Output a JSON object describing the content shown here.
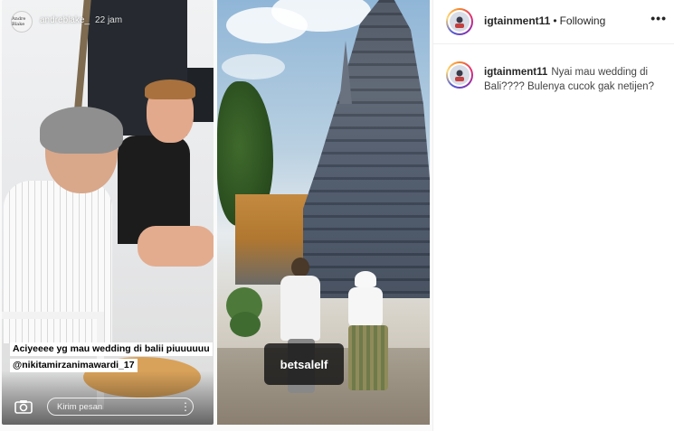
{
  "story": {
    "avatar_text": "Andre Blake",
    "username": "andreblake_",
    "time": "22 jam",
    "caption_line1": "Aciyeeee yg mau wedding di balii piuuuuuu",
    "caption_line2": "@nikitamirzanimawardi_17",
    "reply_placeholder": "Kirim pesan",
    "more_glyph": "⋮"
  },
  "photo": {
    "tag": "betsalelf"
  },
  "sidebar": {
    "header": {
      "username": "igtainment11",
      "separator": "•",
      "follow_status": "Following",
      "more_glyph": "•••"
    },
    "caption": {
      "username": "igtainment11",
      "text": "Nyai mau wedding di Bali???? Bulenya cucok gak netijen?"
    }
  },
  "colors": {
    "story_ring": [
      "#f58529",
      "#dd2a7b",
      "#8134af",
      "#515bd4"
    ],
    "text_primary": "#262626",
    "divider": "#efefef"
  },
  "icons": {
    "camera": "camera-icon",
    "more_story": "more-vertical-icon",
    "more_post": "more-horizontal-icon"
  }
}
